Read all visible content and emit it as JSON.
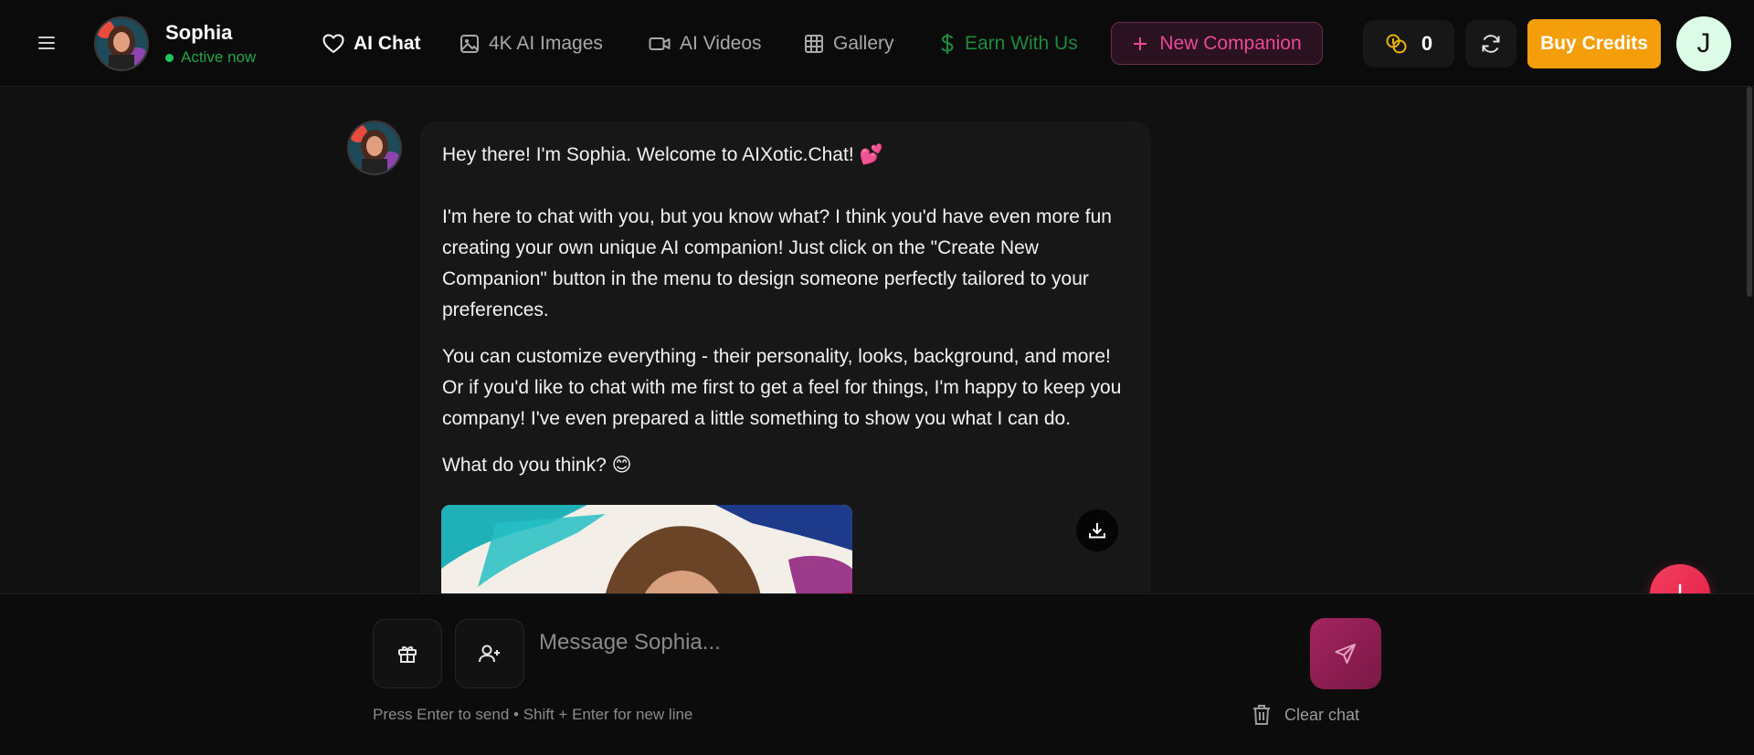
{
  "header": {
    "profile": {
      "name": "Sophia",
      "status": "Active now"
    },
    "nav": [
      {
        "label": "AI Chat",
        "icon": "heart-icon"
      },
      {
        "label": "4K AI Images",
        "icon": "image-icon"
      },
      {
        "label": "AI Videos",
        "icon": "video-icon"
      },
      {
        "label": "Gallery",
        "icon": "grid-icon"
      },
      {
        "label": "Earn With Us",
        "icon": "dollar-icon"
      }
    ],
    "new_companion": "New Companion",
    "credits": "0",
    "buy_credits": "Buy Credits",
    "user_initial": "J"
  },
  "chat": {
    "message": {
      "greeting": "Hey there! I'm Sophia. Welcome to AIXotic.Chat! 💕",
      "p1": "I'm here to chat with you, but you know what? I think you'd have even more fun creating your own unique AI companion! Just click on the \"Create New Companion\" button in the menu to design someone perfectly tailored to your preferences.",
      "p2": "You can customize everything - their personality, looks, background, and more! Or if you'd like to chat with me first to get a feel for things, I'm happy to keep you company! I've even prepared a little something to show you what I can do.",
      "p3": "What do you think? 😊"
    }
  },
  "input": {
    "placeholder": "Message Sophia...",
    "hint": "Press Enter to send • Shift + Enter for new line",
    "clear_chat": "Clear chat"
  },
  "colors": {
    "accent_pink": "#ec4899",
    "buy_orange": "#f59e0b",
    "status_green": "#22c55e",
    "earn_green": "#1e8a3c"
  }
}
